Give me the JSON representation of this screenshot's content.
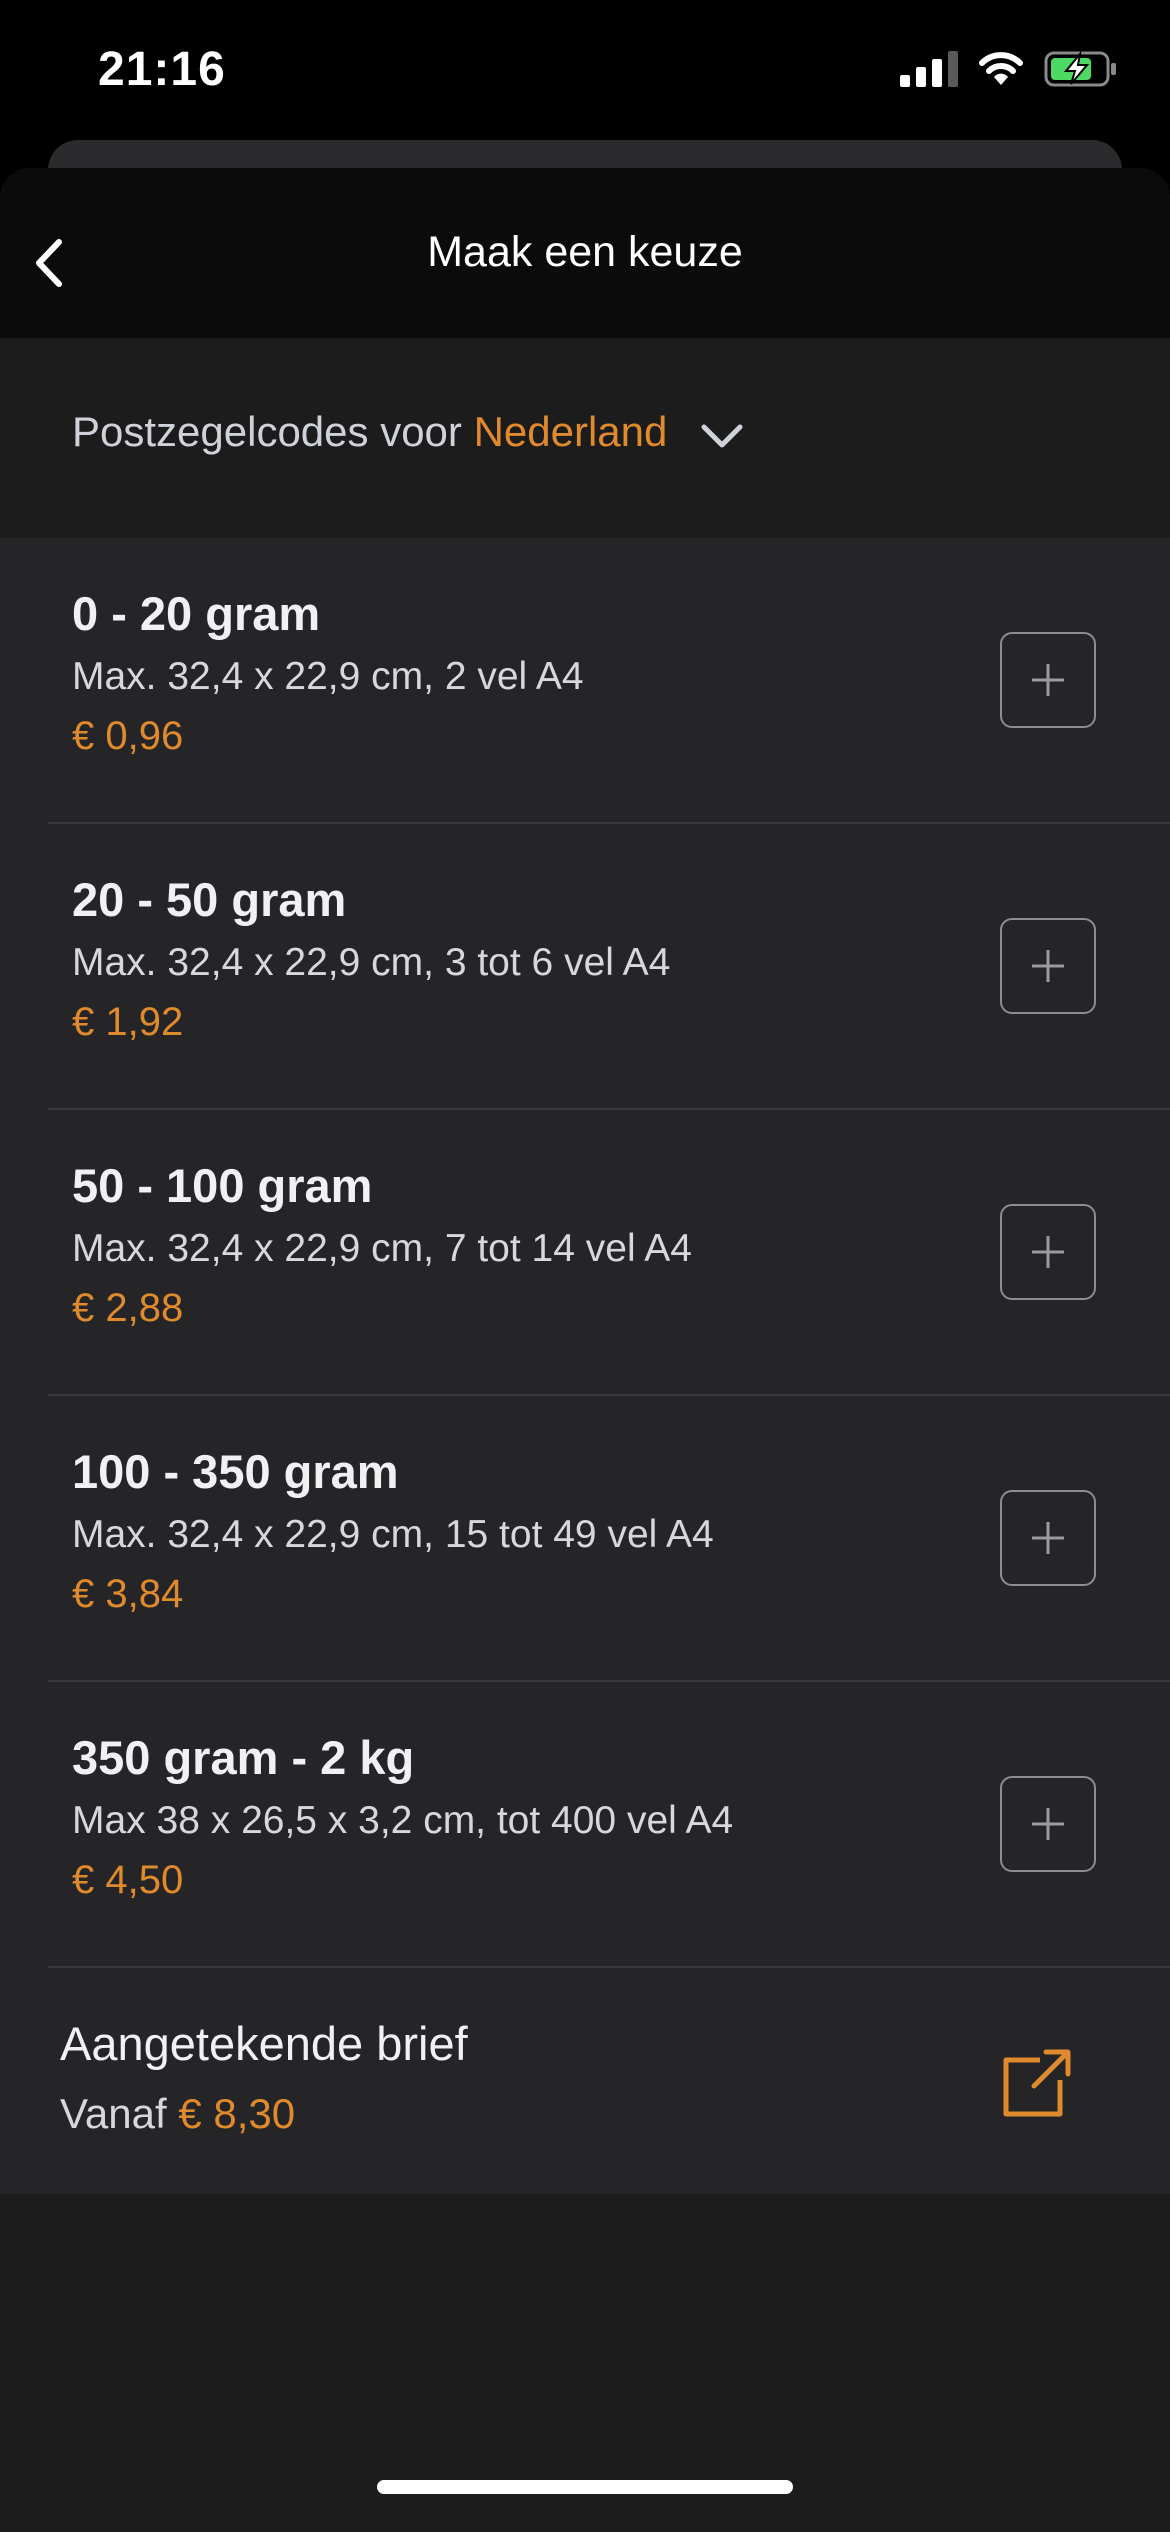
{
  "status_bar": {
    "time": "21:16",
    "signal_bars_active": 3,
    "battery_state": "charging"
  },
  "header": {
    "title": "Maak een keuze",
    "back_icon": "chevron-left-icon"
  },
  "country": {
    "prefix": "Postzegelcodes voor",
    "value": "Nederland",
    "icon": "chevron-down-icon"
  },
  "items": [
    {
      "title": "0 - 20 gram",
      "desc": "Max. 32,4 x 22,9 cm, 2 vel A4",
      "price": "€ 0,96"
    },
    {
      "title": "20 - 50 gram",
      "desc": "Max. 32,4 x 22,9 cm, 3 tot 6 vel A4",
      "price": "€ 1,92"
    },
    {
      "title": "50 - 100 gram",
      "desc": "Max. 32,4 x 22,9 cm, 7 tot 14 vel A4",
      "price": "€ 2,88"
    },
    {
      "title": "100 - 350 gram",
      "desc": "Max. 32,4 x 22,9 cm, 15 tot 49 vel A4",
      "price": "€ 3,84"
    },
    {
      "title": "350 gram - 2 kg",
      "desc": "Max 38 x 26,5 x 3,2 cm, tot 400 vel A4",
      "price": "€ 4,50"
    }
  ],
  "registered": {
    "title": "Aangetekende brief",
    "prefix": "Vanaf",
    "price": "€ 8,30",
    "icon": "external-link-icon"
  },
  "colors": {
    "accent": "#e08a2e",
    "background": "#1c1c1c",
    "list_background": "#252527",
    "header_background": "#0b0b0b"
  }
}
